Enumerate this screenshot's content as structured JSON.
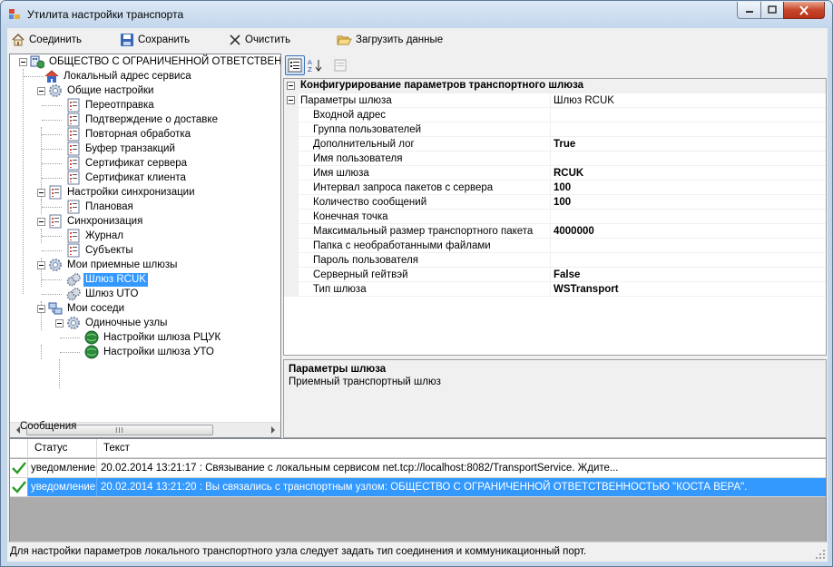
{
  "window": {
    "title": "Утилита настройки транспорта"
  },
  "toolbar": {
    "connect": "Соединить",
    "save": "Сохранить",
    "clear": "Очистить",
    "load": "Загрузить данные"
  },
  "tree": {
    "root": "ОБЩЕСТВО С ОГРАНИЧЕННОЙ ОТВЕТСТВЕННОСТЬЮ",
    "local_address": "Локальный адрес сервиса",
    "general": "Общие настройки",
    "general_items": [
      "Переотправка",
      "Подтверждение о доставке",
      "Повторная обработка",
      "Буфер транзакций",
      "Сертификат сервера",
      "Сертификат клиента"
    ],
    "sync_settings": "Настройки синхронизации",
    "sync_settings_items": [
      "Плановая"
    ],
    "sync": "Синхронизация",
    "sync_items": [
      "Журнал",
      "Субъекты"
    ],
    "gateways": "Мои приемные шлюзы",
    "gateway_items": [
      "Шлюз RCUK",
      "Шлюз UTO"
    ],
    "neighbors": "Мои соседи",
    "single_nodes": "Одиночные узлы",
    "single_node_items": [
      "Настройки шлюза РЦУК",
      "Настройки шлюза УТО"
    ],
    "scroll_grip": "III"
  },
  "props": {
    "category": "Конфигурирование параметров транспортного шлюза",
    "group_name": "Параметры шлюза",
    "group_value": "Шлюз RCUK",
    "rows": [
      {
        "name": "Входной адрес",
        "value": ""
      },
      {
        "name": "Группа пользователей",
        "value": ""
      },
      {
        "name": "Дополнительный лог",
        "value": "True"
      },
      {
        "name": "Имя пользователя",
        "value": ""
      },
      {
        "name": "Имя шлюза",
        "value": "RCUK"
      },
      {
        "name": "Интервал запроса пакетов с сервера",
        "value": "100"
      },
      {
        "name": "Количество сообщений",
        "value": "100"
      },
      {
        "name": "Конечная точка",
        "value": ""
      },
      {
        "name": "Максимальный размер транспортного пакета",
        "value": "4000000"
      },
      {
        "name": "Папка с необработанными файлами",
        "value": ""
      },
      {
        "name": "Пароль пользователя",
        "value": ""
      },
      {
        "name": "Серверный гейтвэй",
        "value": "False"
      },
      {
        "name": "Тип шлюза",
        "value": "WSTransport"
      }
    ],
    "desc_title": "Параметры шлюза",
    "desc_text": "Приемный транспортный шлюз"
  },
  "messages": {
    "header": "Сообщения",
    "col_status": "Статус",
    "col_text": "Текст",
    "rows": [
      {
        "status": "уведомление",
        "text": "20.02.2014 13:21:17 : Связывание с локальным сервисом net.tcp://localhost:8082/TransportService. Ждите..."
      },
      {
        "status": "уведомление",
        "text": "20.02.2014 13:21:20 : Вы связались с транспортным узлом: ОБЩЕСТВО С ОГРАНИЧЕННОЙ ОТВЕТСТВЕННОСТЬЮ \"КОСТА ВЕРА\"."
      }
    ]
  },
  "status": {
    "text": "Для настройки параметров локального транспортного узла следует задать тип соединения и коммуникационный порт."
  }
}
